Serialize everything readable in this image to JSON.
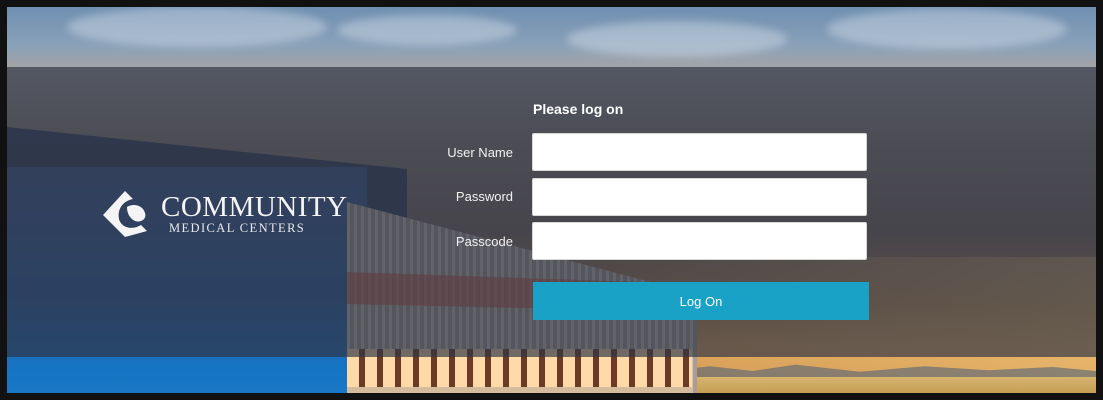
{
  "brand": {
    "name": "COMMUNITY",
    "subtitle": "MEDICAL CENTERS",
    "logo_icon": "community-medical-centers-logo-icon"
  },
  "form": {
    "title": "Please log on",
    "fields": [
      {
        "label": "User Name",
        "type": "text",
        "value": "",
        "placeholder": ""
      },
      {
        "label": "Password",
        "type": "password",
        "value": "",
        "placeholder": ""
      },
      {
        "label": "Passcode",
        "type": "password",
        "value": "",
        "placeholder": ""
      }
    ],
    "submit_label": "Log On"
  },
  "colors": {
    "accent": "#19a1c6",
    "overlay": "#2e3444"
  }
}
